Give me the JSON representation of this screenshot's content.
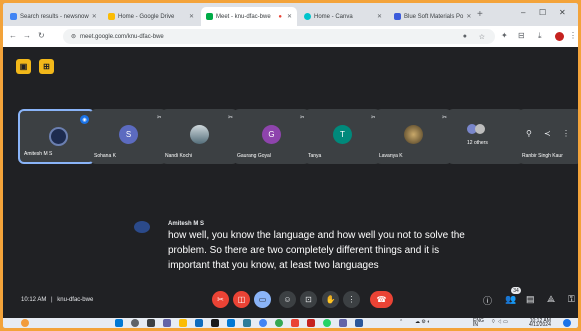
{
  "browser": {
    "tabs": [
      {
        "title": "Search results - newsnow",
        "favicon_color": "#4285f4",
        "active": false
      },
      {
        "title": "Home - Google Drive",
        "favicon_color": "#fbbc04",
        "active": false
      },
      {
        "title": "Meet - knu-dfac-bwe",
        "favicon_color": "#00ac47",
        "active": true
      },
      {
        "title": "Home - Canva",
        "favicon_color": "#00c4cc",
        "active": false
      },
      {
        "title": "Blue Soft Materials Po",
        "favicon_color": "#3b5bdb",
        "active": false
      }
    ],
    "url": "meet.google.com/knu-dfac-bwe"
  },
  "meeting": {
    "code": "knu-dfac-bwe",
    "time": "10:12 AM",
    "separator": "|",
    "participants": [
      {
        "name": "Amitesh M S",
        "pinned": true,
        "avatar_type": "photo",
        "avatar_color": "#1d2b4f"
      },
      {
        "name": "Sohana K",
        "initial": "S",
        "avatar_color": "#5c6bc0"
      },
      {
        "name": "Nandi Kochi",
        "avatar_type": "photo",
        "avatar_color": "#7a8a99"
      },
      {
        "name": "Gaurang Goyal",
        "initial": "G",
        "avatar_color": "#8e44ad"
      },
      {
        "name": "Tanya",
        "initial": "T",
        "avatar_color": "#00897b"
      },
      {
        "name": "Lavanya K",
        "avatar_type": "photo",
        "avatar_color": "#6d5a3c"
      },
      {
        "name": "12 others",
        "avatar_color": "#5f6368"
      },
      {
        "name": "Ranbir Singh Kaur",
        "avatar_color": "#3c4043"
      }
    ],
    "others_count": "12",
    "people_count": "34"
  },
  "captions": {
    "speaker": "Amitesh M S",
    "lines": [
      "how well, you know the language and how well you not to solve the",
      "problem. So there are two completely different things and it is",
      "important that you know, at least two languages"
    ]
  },
  "taskbar": {
    "lang": "ENG",
    "lang_region": "IN",
    "time": "10:12 AM",
    "date": "4/11/2024"
  },
  "colors": {
    "frame": "#f3a33a",
    "meet_bg": "#202124",
    "tile_bg": "#3c4043",
    "red": "#ea4335",
    "pin_border": "#8ab4f8"
  }
}
